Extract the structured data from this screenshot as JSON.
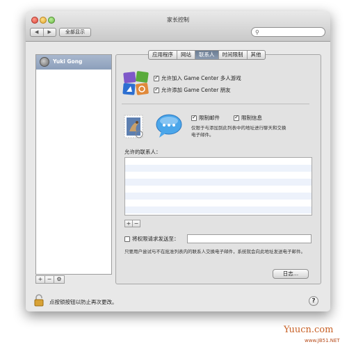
{
  "window": {
    "title": "家长控制"
  },
  "toolbar": {
    "back_label": "◀",
    "forward_label": "▶",
    "show_all_label": "全部显示",
    "search_placeholder": ""
  },
  "sidebar": {
    "user_name": "Yuki Gong",
    "add_label": "+",
    "remove_label": "−",
    "gear_label": "⚙"
  },
  "tabs": [
    "应用程序",
    "网站",
    "联系人",
    "时间限制",
    "其他"
  ],
  "active_tab": "联系人",
  "game_center": {
    "allow_multiplayer": {
      "label": "允许加入 Game Center 多人游戏",
      "checked": true
    },
    "allow_friends": {
      "label": "允许添加 Game Center 朋友",
      "checked": true
    }
  },
  "restrictions": {
    "limit_mail": {
      "label": "限制邮件",
      "checked": true
    },
    "limit_messages": {
      "label": "限制信息",
      "checked": true
    },
    "note": "仅限于与添加到此列表中的地址进行聊天和交换电子邮件。"
  },
  "contacts": {
    "label": "允许的联系人：",
    "items": [],
    "add_label": "+",
    "remove_label": "−"
  },
  "permission_request": {
    "label": "将权限请求发送至：",
    "checked": false,
    "value": "",
    "note": "只要用户尝试与不在批准列表内的联系人交换电子邮件，系统就会向此地址发送电子邮件。"
  },
  "log_button": "日志…",
  "lock": {
    "text": "点按锁按钮以防止再次更改。"
  },
  "help_label": "?",
  "watermark": {
    "main": "Yuucn.com",
    "sub": "www.JB51.NET"
  },
  "colors": {
    "selected_row": "#9aabc5",
    "active_tab": "#7a8ca3",
    "list_stripe": "#edf2fb"
  }
}
